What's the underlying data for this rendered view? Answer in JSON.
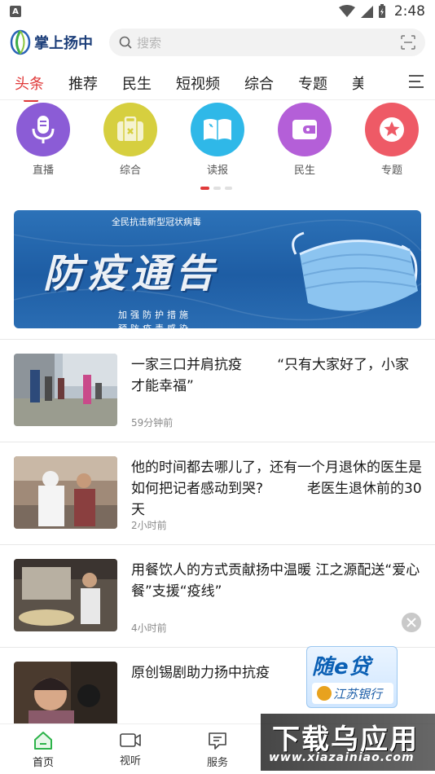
{
  "status_bar": {
    "time": "2:48",
    "notification_badge": "A"
  },
  "header": {
    "logo_text": "掌上扬中",
    "search_placeholder": "搜索"
  },
  "tabs": [
    {
      "label": "头条",
      "active": true
    },
    {
      "label": "推荐",
      "active": false
    },
    {
      "label": "民生",
      "active": false
    },
    {
      "label": "短视频",
      "active": false
    },
    {
      "label": "综合",
      "active": false
    },
    {
      "label": "专题",
      "active": false
    },
    {
      "label": "美",
      "active": false
    }
  ],
  "categories": [
    {
      "label": "直播",
      "color": "#8b5cd6",
      "icon": "microphone-icon"
    },
    {
      "label": "综合",
      "color": "#d6cf3f",
      "icon": "briefcase-icon"
    },
    {
      "label": "读报",
      "color": "#2fb8e8",
      "icon": "book-icon"
    },
    {
      "label": "民生",
      "color": "#b45fd8",
      "icon": "wallet-icon"
    },
    {
      "label": "专题",
      "color": "#ee5a66",
      "icon": "star-icon"
    }
  ],
  "carousel": {
    "pages": 3,
    "active_page": 1
  },
  "banner": {
    "subtitle": "全民抗击新型冠状病毒",
    "headline": "防疫通告",
    "line1": "加强防护措施",
    "line2": "预防疫毒感染"
  },
  "news": [
    {
      "title": "一家三口并肩抗疫        “只有大家好了，小家才能幸福”",
      "time": "59分钟前"
    },
    {
      "title": "他的时间都去哪儿了，还有一个月退休的医生是如何把记者感动到哭?          老医生退休前的30天",
      "time": "2小时前"
    },
    {
      "title": "用餐饮人的方式贡献扬中温暖 江之源配送“爱心餐”支援“疫线”",
      "time": "4小时前"
    },
    {
      "title": "原创锡剧助力扬中抗疫",
      "time": ""
    }
  ],
  "ad": {
    "title": "随e贷",
    "bank": "江苏银行"
  },
  "watermark": {
    "title": "下载乌应用",
    "url": "www.xiazainiao.com"
  },
  "bottom_nav": [
    {
      "label": "首页",
      "active": true
    },
    {
      "label": "视听",
      "active": false
    },
    {
      "label": "服务",
      "active": false
    }
  ],
  "colors": {
    "accent": "#e03a3a",
    "brand_blue": "#1d3f7a"
  }
}
